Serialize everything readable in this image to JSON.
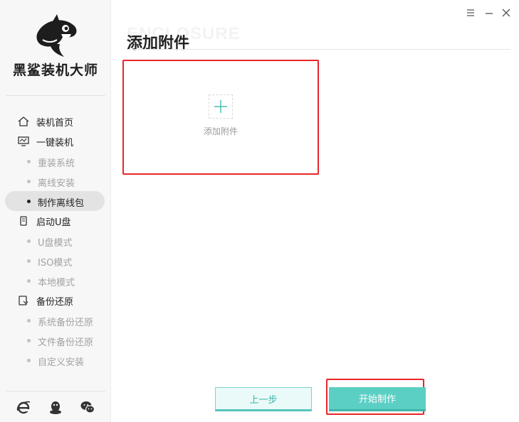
{
  "app": {
    "brand": "黑鲨装机大师"
  },
  "sidebar": {
    "sections": [
      {
        "label": "装机首页",
        "icon": "home-icon"
      },
      {
        "label": "一键装机",
        "icon": "monitor-icon"
      },
      {
        "label": "重装系统",
        "sub": true
      },
      {
        "label": "离线安装",
        "sub": true
      },
      {
        "label": "制作离线包",
        "sub": true,
        "active": true
      },
      {
        "label": "启动U盘",
        "icon": "usb-icon"
      },
      {
        "label": "U盘模式",
        "sub": true
      },
      {
        "label": "ISO模式",
        "sub": true
      },
      {
        "label": "本地模式",
        "sub": true
      },
      {
        "label": "备份还原",
        "icon": "backup-icon"
      },
      {
        "label": "系统备份还原",
        "sub": true
      },
      {
        "label": "文件备份还原",
        "sub": true
      },
      {
        "label": "自定义安装",
        "sub": true
      }
    ],
    "bottom_icons": [
      "ie-browser-icon",
      "qq-icon",
      "wechat-icon"
    ]
  },
  "window_controls": [
    "menu-icon",
    "minimize-icon",
    "close-icon"
  ],
  "main": {
    "watermark": "ENCLOSURE",
    "title": "添加附件",
    "attach_label": "添加附件"
  },
  "footer": {
    "prev_label": "上一步",
    "start_label": "开始制作"
  },
  "colors": {
    "accent": "#5ccfc4",
    "highlight_red": "#e8262a",
    "sidebar_bg": "#f7f7f7"
  }
}
